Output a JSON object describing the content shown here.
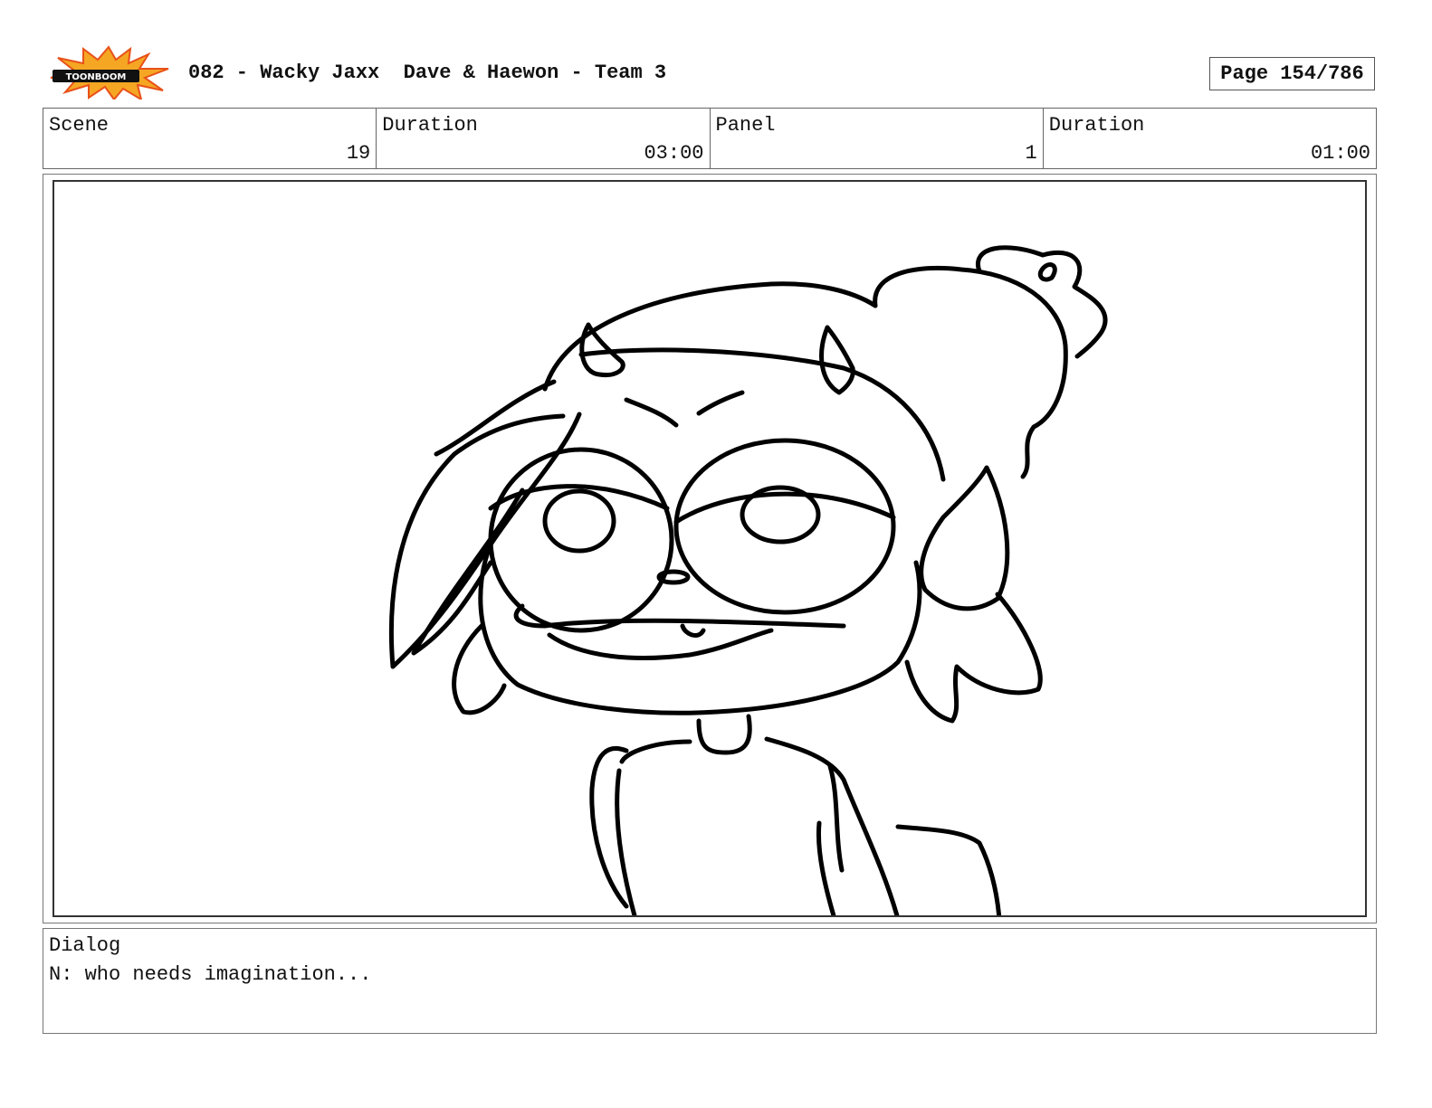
{
  "header": {
    "logo_text": "TOONBOOM",
    "title": "082 - Wacky Jaxx  Dave & Haewon - Team 3",
    "page": "Page 154/786"
  },
  "info": [
    {
      "label": "Scene",
      "value": "19"
    },
    {
      "label": "Duration",
      "value": "03:00"
    },
    {
      "label": "Panel",
      "value": "1"
    },
    {
      "label": "Duration",
      "value": "01:00"
    }
  ],
  "dialog": {
    "label": "Dialog",
    "text": "N: who needs imagination..."
  },
  "colors": {
    "logo_orange": "#f5a623",
    "logo_red": "#e8511a",
    "ink": "#000000"
  }
}
